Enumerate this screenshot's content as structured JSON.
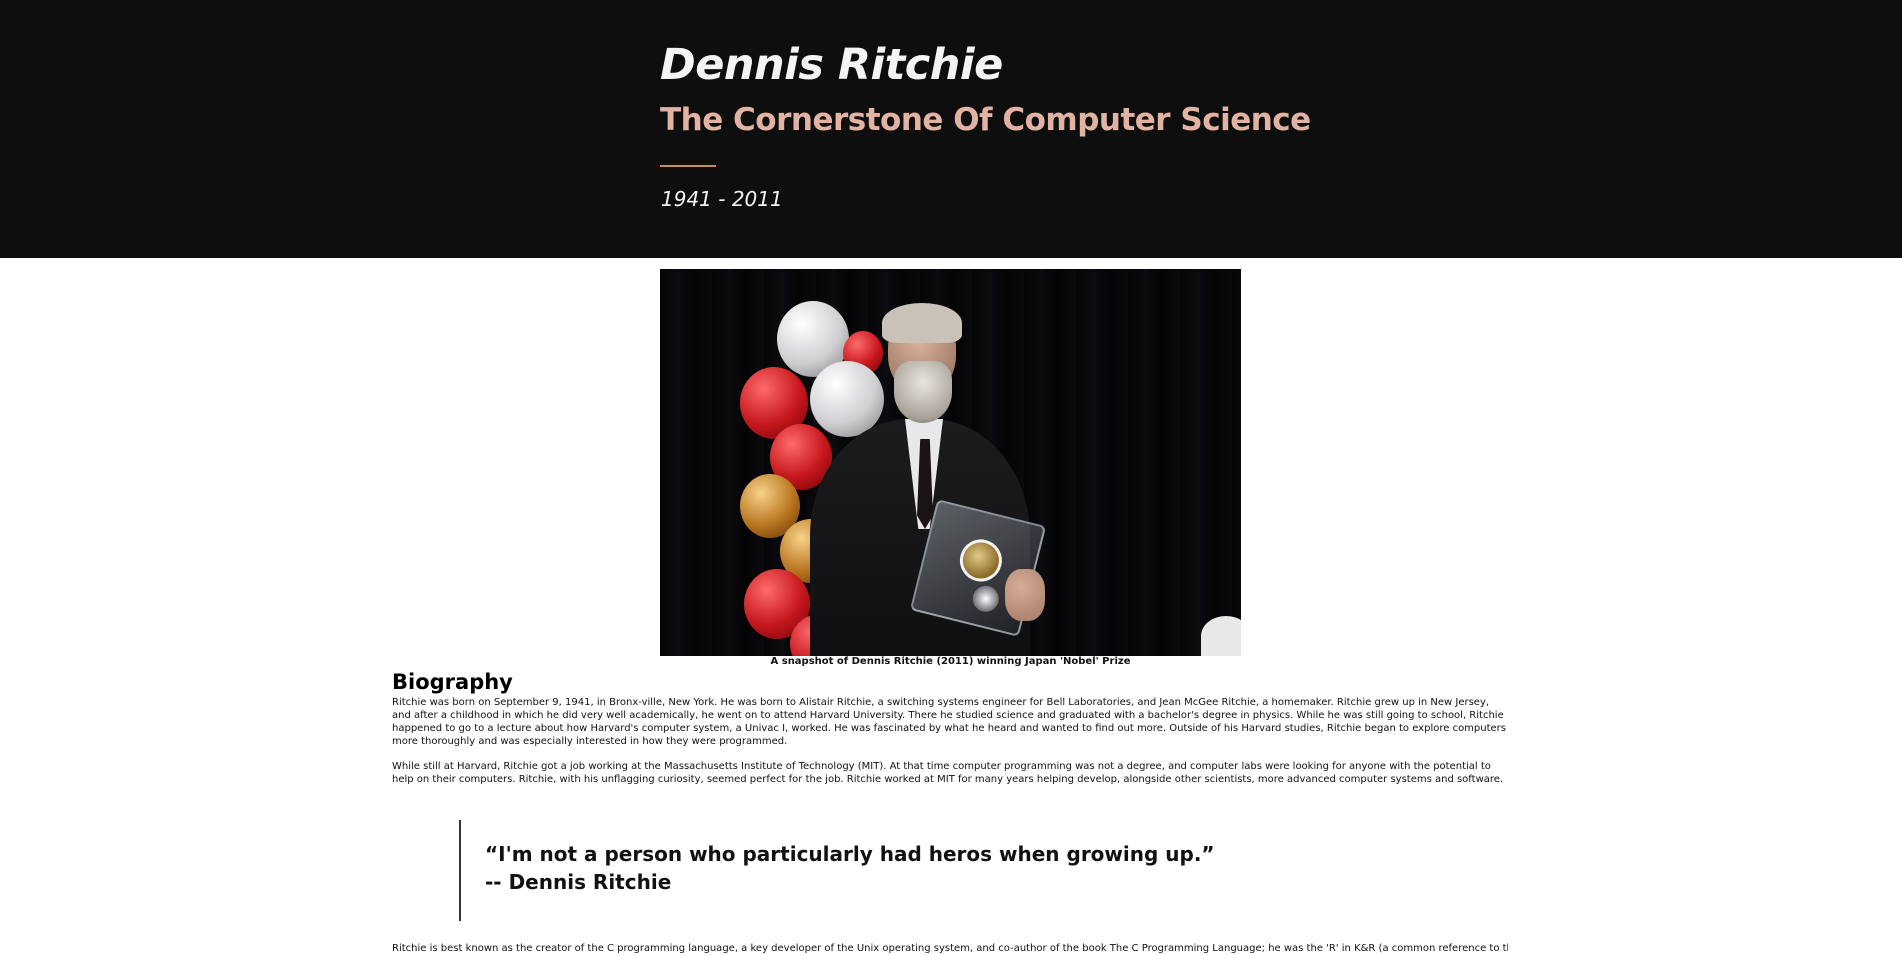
{
  "header": {
    "title": "Dennis Ritchie",
    "subtitle": "The Cornerstone Of Computer Science",
    "years": "1941 - 2011"
  },
  "figure": {
    "caption": "A snapshot of Dennis Ritchie (2011) winning Japan 'Nobel' Prize"
  },
  "biography": {
    "heading": "Biography",
    "paragraphs": [
      "Ritchie was born on September 9, 1941, in Bronx-ville, New York. He was born to Alistair Ritchie, a switching systems engineer for Bell Laboratories, and Jean McGee Ritchie, a homemaker. Ritchie grew up in New Jersey, and after a childhood in which he did very well academically, he went on to attend Harvard University. There he studied science and graduated with a bachelor's degree in physics. While he was still going to school, Ritchie happened to go to a lecture about how Harvard's computer system, a Univac I, worked. He was fascinated by what he heard and wanted to find out more. Outside of his Harvard studies, Ritchie began to explore computers more thoroughly and was especially interested in how they were programmed.",
      "While still at Harvard, Ritchie got a job working at the Massachusetts Institute of Technology (MIT). At that time computer programming was not a degree, and computer labs were looking for anyone with the potential to help on their computers. Ritchie, with his unflagging curiosity, seemed perfect for the job. Ritchie worked at MIT for many years helping develop, alongside other scientists, more advanced computer systems and software."
    ]
  },
  "quote": {
    "text": "“I'm not a person who particularly had heros when growing up.”",
    "author": "-- Dennis Ritchie"
  },
  "after_quote": {
    "text": "Ritchie is best known as the creator of the C programming language, a key developer of the Unix operating system, and co-author of the book The C Programming Language; he was the 'R' in K&R (a common reference to the book's authors"
  }
}
